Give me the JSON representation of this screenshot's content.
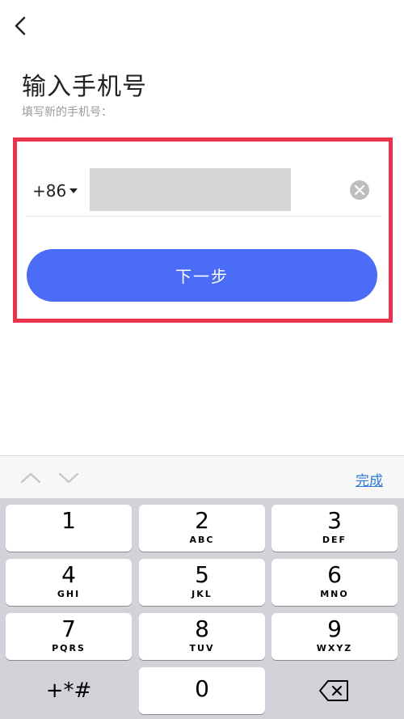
{
  "header": {
    "title": "输入手机号",
    "subtitle": "填写新的手机号："
  },
  "form": {
    "country_code": "+86",
    "phone_value": "",
    "next_label": "下一步"
  },
  "keyboard_toolbar": {
    "done_label": "完成"
  },
  "keypad": [
    {
      "num": "1",
      "letters": ""
    },
    {
      "num": "2",
      "letters": "ABC"
    },
    {
      "num": "3",
      "letters": "DEF"
    },
    {
      "num": "4",
      "letters": "GHI"
    },
    {
      "num": "5",
      "letters": "JKL"
    },
    {
      "num": "6",
      "letters": "MNO"
    },
    {
      "num": "7",
      "letters": "PQRS"
    },
    {
      "num": "8",
      "letters": "TUV"
    },
    {
      "num": "9",
      "letters": "WXYZ"
    },
    {
      "num": "+*#",
      "letters": ""
    },
    {
      "num": "0",
      "letters": ""
    }
  ],
  "colors": {
    "accent": "#4a6cf7",
    "highlight": "#e8334a",
    "link": "#2b7ad6"
  }
}
